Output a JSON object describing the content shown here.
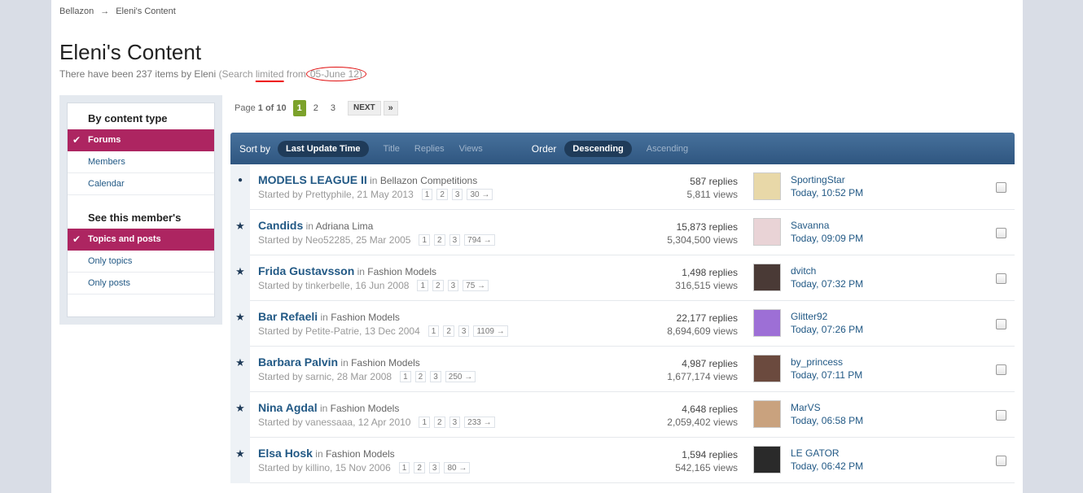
{
  "breadcrumb": {
    "home": "Bellazon",
    "separator": "→",
    "current": "Eleni's Content"
  },
  "page_title": "Eleni's Content",
  "subtitle": {
    "main": "There have been 237 items by Eleni",
    "open": "(Search",
    "limited": "limited",
    "from": "from",
    "date": "05-June 12)"
  },
  "sidebar": {
    "heading1": "By content type",
    "types": [
      "Forums",
      "Members",
      "Calendar"
    ],
    "heading2": "See this member's",
    "views": [
      "Topics and posts",
      "Only topics",
      "Only posts"
    ]
  },
  "pagination": {
    "label_prefix": "Page",
    "label_current": "1 of 10",
    "pages": [
      "1",
      "2",
      "3"
    ],
    "next": "NEXT",
    "last": "»"
  },
  "sortbar": {
    "sort_by": "Sort by",
    "sort_active": "Last Update Time",
    "sort_options": [
      "Title",
      "Replies",
      "Views"
    ],
    "order": "Order",
    "order_active": "Descending",
    "order_option": "Ascending"
  },
  "topics": [
    {
      "title": "MODELS LEAGUE II",
      "in": "in",
      "forum": "Bellazon Competitions",
      "started": "Started by Prettyphile, 21 May 2013",
      "pages": [
        "1",
        "2",
        "3",
        "30 →"
      ],
      "replies": "587 replies",
      "views": "5,811 views",
      "last_user": "SportingStar",
      "last_time": "Today, 10:52 PM",
      "marker": "dot",
      "avatar": "#e8d8a8"
    },
    {
      "title": "Candids",
      "in": "in",
      "forum": "Adriana Lima",
      "started": "Started by Neo52285, 25 Mar 2005",
      "pages": [
        "1",
        "2",
        "3",
        "794 →"
      ],
      "replies": "15,873 replies",
      "views": "5,304,500 views",
      "last_user": "Savanna",
      "last_time": "Today, 09:09 PM",
      "marker": "star",
      "avatar": "#e9d3d6"
    },
    {
      "title": "Frida Gustavsson",
      "in": "in",
      "forum": "Fashion Models",
      "started": "Started by tinkerbelle, 16 Jun 2008",
      "pages": [
        "1",
        "2",
        "3",
        "75 →"
      ],
      "replies": "1,498 replies",
      "views": "316,515 views",
      "last_user": "dvitch",
      "last_time": "Today, 07:32 PM",
      "marker": "star",
      "avatar": "#4a3a36"
    },
    {
      "title": "Bar Refaeli",
      "in": "in",
      "forum": "Fashion Models",
      "started": "Started by Petite-Patrie, 13 Dec 2004",
      "pages": [
        "1",
        "2",
        "3",
        "1109 →"
      ],
      "replies": "22,177 replies",
      "views": "8,694,609 views",
      "last_user": "Glitter92",
      "last_time": "Today, 07:26 PM",
      "marker": "star",
      "avatar": "#9d6fd6"
    },
    {
      "title": "Barbara Palvin",
      "in": "in",
      "forum": "Fashion Models",
      "started": "Started by sarnic, 28 Mar 2008",
      "pages": [
        "1",
        "2",
        "3",
        "250 →"
      ],
      "replies": "4,987 replies",
      "views": "1,677,174 views",
      "last_user": "by_princess",
      "last_time": "Today, 07:11 PM",
      "marker": "star",
      "avatar": "#6b4a3e"
    },
    {
      "title": "Nina Agdal",
      "in": "in",
      "forum": "Fashion Models",
      "started": "Started by vanessaaa, 12 Apr 2010",
      "pages": [
        "1",
        "2",
        "3",
        "233 →"
      ],
      "replies": "4,648 replies",
      "views": "2,059,402 views",
      "last_user": "MarVS",
      "last_time": "Today, 06:58 PM",
      "marker": "star",
      "avatar": "#c9a27e"
    },
    {
      "title": "Elsa Hosk",
      "in": "in",
      "forum": "Fashion Models",
      "started": "Started by killino, 15 Nov 2006",
      "pages": [
        "1",
        "2",
        "3",
        "80 →"
      ],
      "replies": "1,594 replies",
      "views": "542,165 views",
      "last_user": "LE GATOR",
      "last_time": "Today, 06:42 PM",
      "marker": "star",
      "avatar": "#2a2a2a"
    }
  ]
}
